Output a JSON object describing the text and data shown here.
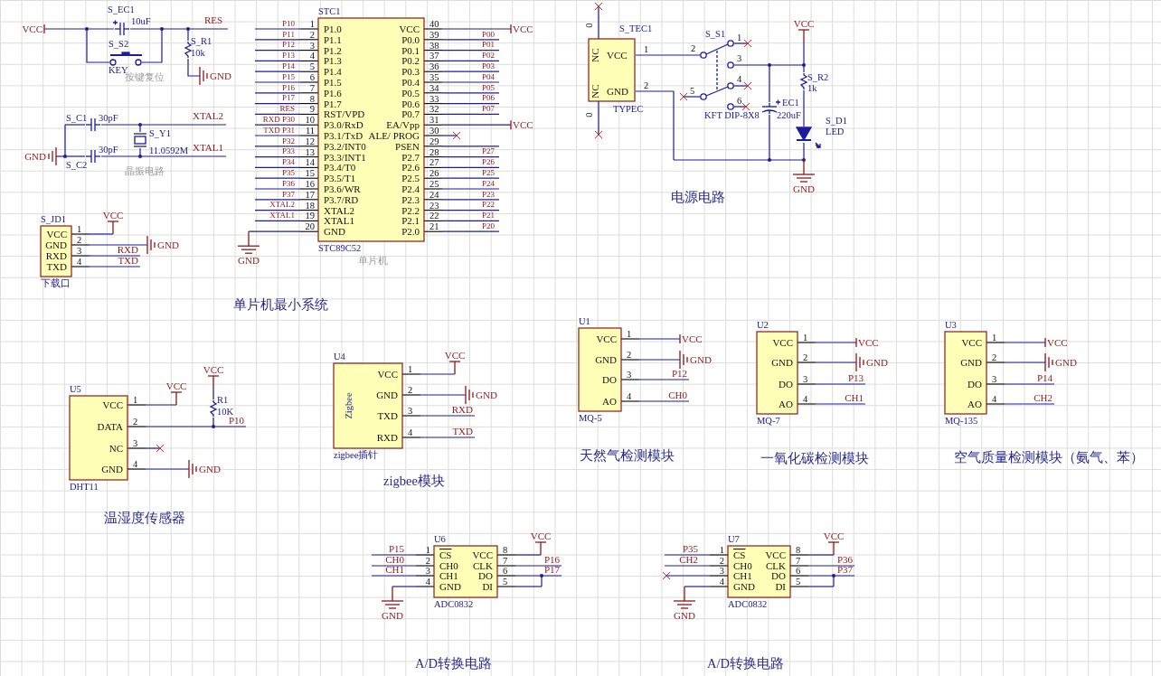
{
  "ics": [
    {
      "designator": "S_JD1",
      "part": "下载口",
      "pins_right": [
        {
          "number": "1",
          "name": "VCC",
          "net": "VCC",
          "kind": "power"
        },
        {
          "number": "2",
          "name": "GND",
          "net": "GND",
          "kind": "ground"
        },
        {
          "number": "3",
          "name": "RXD",
          "net": "RXD",
          "kind": "label"
        },
        {
          "number": "4",
          "name": "TXD",
          "net": "TXD",
          "kind": "label"
        }
      ]
    },
    {
      "designator": "STC1",
      "part": "STC89C52",
      "comment": "单片机",
      "pins_left": [
        {
          "number": "1",
          "name": "P1.0",
          "net": "P10",
          "kind": "label"
        },
        {
          "number": "2",
          "name": "P1.1",
          "net": "P11",
          "kind": "label"
        },
        {
          "number": "3",
          "name": "P1.2",
          "net": "P12",
          "kind": "label"
        },
        {
          "number": "4",
          "name": "P1.3",
          "net": "P13",
          "kind": "label"
        },
        {
          "number": "5",
          "name": "P1.4",
          "net": "P14",
          "kind": "label"
        },
        {
          "number": "6",
          "name": "P1.5",
          "net": "P15",
          "kind": "label"
        },
        {
          "number": "7",
          "name": "P1.6",
          "net": "P16",
          "kind": "label"
        },
        {
          "number": "8",
          "name": "P1.7",
          "net": "P17",
          "kind": "label"
        },
        {
          "number": "9",
          "name": "RST/VPD",
          "net": "RES",
          "kind": "label"
        },
        {
          "number": "10",
          "name": "P3.0/RxD",
          "net": "RXD P30",
          "kind": "label"
        },
        {
          "number": "11",
          "name": "P3.1/TxD",
          "net": "TXD P31",
          "kind": "label"
        },
        {
          "number": "12",
          "name": "P3.2/INT0",
          "net": "P32",
          "kind": "label"
        },
        {
          "number": "13",
          "name": "P3.3/INT1",
          "net": "P33",
          "kind": "label"
        },
        {
          "number": "14",
          "name": "P3.4/T0",
          "net": "P34",
          "kind": "label"
        },
        {
          "number": "15",
          "name": "P3.5/T1",
          "net": "P35",
          "kind": "label"
        },
        {
          "number": "16",
          "name": "P3.6/WR",
          "net": "P36",
          "kind": "label"
        },
        {
          "number": "17",
          "name": "P3.7/RD",
          "net": "P37",
          "kind": "label"
        },
        {
          "number": "18",
          "name": "XTAL2",
          "net": "XTAL2",
          "kind": "label"
        },
        {
          "number": "19",
          "name": "XTAL1",
          "net": "XTAL1",
          "kind": "label"
        },
        {
          "number": "20",
          "name": "GND",
          "net": "GND",
          "kind": "ground"
        }
      ],
      "pins_right": [
        {
          "number": "40",
          "name": "VCC",
          "net": "VCC",
          "kind": "power"
        },
        {
          "number": "39",
          "name": "P0.0",
          "net": "P00",
          "kind": "label"
        },
        {
          "number": "38",
          "name": "P0.1",
          "net": "P01",
          "kind": "label"
        },
        {
          "number": "37",
          "name": "P0.2",
          "net": "P02",
          "kind": "label"
        },
        {
          "number": "36",
          "name": "P0.3",
          "net": "P03",
          "kind": "label"
        },
        {
          "number": "35",
          "name": "P0.4",
          "net": "P04",
          "kind": "label"
        },
        {
          "number": "34",
          "name": "P0.5",
          "net": "P05",
          "kind": "label"
        },
        {
          "number": "33",
          "name": "P0.6",
          "net": "P06",
          "kind": "label"
        },
        {
          "number": "32",
          "name": "P0.7",
          "net": "P07",
          "kind": "label"
        },
        {
          "number": "31",
          "name": "EA/Vpp",
          "net": "VCC",
          "kind": "power"
        },
        {
          "number": "30",
          "name": "ALE/ PROG",
          "kind": "noconnect"
        },
        {
          "number": "29",
          "name": "PSEN",
          "kind": "plain"
        },
        {
          "number": "28",
          "name": "P2.7",
          "net": "P27",
          "kind": "label"
        },
        {
          "number": "27",
          "name": "P2.6",
          "net": "P26",
          "kind": "label"
        },
        {
          "number": "26",
          "name": "P2.5",
          "net": "P25",
          "kind": "label"
        },
        {
          "number": "25",
          "name": "P2.4",
          "net": "P24",
          "kind": "label"
        },
        {
          "number": "24",
          "name": "P2.3",
          "net": "P23",
          "kind": "label"
        },
        {
          "number": "23",
          "name": "P2.2",
          "net": "P22",
          "kind": "label"
        },
        {
          "number": "22",
          "name": "P2.1",
          "net": "P21",
          "kind": "label"
        },
        {
          "number": "21",
          "name": "P2.0",
          "net": "P20",
          "kind": "label"
        }
      ]
    },
    {
      "designator": "U5",
      "part": "DHT11",
      "pins_right": [
        {
          "number": "1",
          "name": "VCC",
          "net": "VCC",
          "kind": "power"
        },
        {
          "number": "2",
          "name": "DATA",
          "net": "P10",
          "kind": "label"
        },
        {
          "number": "3",
          "name": "NC",
          "kind": "noconnect"
        },
        {
          "number": "4",
          "name": "GND",
          "net": "GND",
          "kind": "ground"
        }
      ]
    },
    {
      "designator": "U4",
      "part": "zigbee插针",
      "body_label": "Zigbee",
      "pins_right": [
        {
          "number": "1",
          "name": "VCC",
          "net": "VCC",
          "kind": "power"
        },
        {
          "number": "2",
          "name": "GND",
          "net": "GND",
          "kind": "ground"
        },
        {
          "number": "3",
          "name": "TXD",
          "net": "RXD",
          "kind": "label"
        },
        {
          "number": "4",
          "name": "RXD",
          "net": "TXD",
          "kind": "label"
        }
      ]
    },
    {
      "designator": "U1",
      "part": "MQ-5",
      "pins_right": [
        {
          "number": "1",
          "name": "VCC",
          "net": "VCC",
          "kind": "power"
        },
        {
          "number": "2",
          "name": "GND",
          "net": "GND",
          "kind": "ground"
        },
        {
          "number": "3",
          "name": "DO",
          "net": "P12",
          "kind": "label"
        },
        {
          "number": "4",
          "name": "AO",
          "net": "CH0",
          "kind": "label"
        }
      ]
    },
    {
      "designator": "U2",
      "part": "MQ-7",
      "pins_right": [
        {
          "number": "1",
          "name": "VCC",
          "net": "VCC",
          "kind": "power"
        },
        {
          "number": "2",
          "name": "GND",
          "net": "GND",
          "kind": "ground"
        },
        {
          "number": "3",
          "name": "DO",
          "net": "P13",
          "kind": "label"
        },
        {
          "number": "4",
          "name": "AO",
          "net": "CH1",
          "kind": "label"
        }
      ]
    },
    {
      "designator": "U3",
      "part": "MQ-135",
      "pins_right": [
        {
          "number": "1",
          "name": "VCC",
          "net": "VCC",
          "kind": "power"
        },
        {
          "number": "2",
          "name": "GND",
          "net": "GND",
          "kind": "ground"
        },
        {
          "number": "3",
          "name": "DO",
          "net": "P14",
          "kind": "label"
        },
        {
          "number": "4",
          "name": "AO",
          "net": "CH2",
          "kind": "label"
        }
      ]
    },
    {
      "designator": "U6",
      "part": "ADC0832",
      "pins_left": [
        {
          "number": "1",
          "name": "CS",
          "active_low": true,
          "net": "P15",
          "kind": "label"
        },
        {
          "number": "2",
          "name": "CH0",
          "active_low": false,
          "net": "CH0",
          "kind": "label"
        },
        {
          "number": "3",
          "name": "CH1",
          "active_low": false,
          "net": "CH1",
          "kind": "label"
        },
        {
          "number": "4",
          "name": "GND",
          "active_low": false,
          "net": "GND",
          "kind": "ground"
        }
      ],
      "pins_right": [
        {
          "number": "8",
          "name": "VCC",
          "active_low": false,
          "net": "VCC",
          "kind": "power"
        },
        {
          "number": "7",
          "name": "CLK",
          "active_low": false,
          "net": "P16",
          "kind": "label"
        },
        {
          "number": "6",
          "name": "DO",
          "active_low": false,
          "net": "P17",
          "kind": "label"
        },
        {
          "number": "5",
          "name": "DI",
          "active_low": false,
          "kind": "plain"
        }
      ]
    },
    {
      "designator": "U7",
      "part": "ADC0832",
      "pins_left": [
        {
          "number": "1",
          "name": "CS",
          "active_low": true,
          "net": "P35",
          "kind": "label"
        },
        {
          "number": "2",
          "name": "CH0",
          "active_low": false,
          "net": "CH2",
          "kind": "label"
        },
        {
          "number": "3",
          "name": "CH1",
          "active_low": false,
          "kind": "noconnect"
        },
        {
          "number": "4",
          "name": "GND",
          "active_low": false,
          "net": "GND",
          "kind": "ground"
        }
      ],
      "pins_right": [
        {
          "number": "8",
          "name": "VCC",
          "active_low": false,
          "net": "VCC",
          "kind": "power"
        },
        {
          "number": "7",
          "name": "CLK",
          "active_low": false,
          "net": "P36",
          "kind": "label"
        },
        {
          "number": "6",
          "name": "DO",
          "active_low": false,
          "net": "P37",
          "kind": "label"
        },
        {
          "number": "5",
          "name": "DI",
          "active_low": false,
          "kind": "plain"
        }
      ]
    }
  ],
  "discretes": [
    {
      "kind": "capacitor",
      "designator": "S_EC1",
      "value": "10uF",
      "polarized": true
    },
    {
      "kind": "pushbutton",
      "designator": "S_S2",
      "value": "KEY"
    },
    {
      "kind": "resistor",
      "designator": "S_R1",
      "value": "10k"
    },
    {
      "kind": "capacitor",
      "designator": "S_C1",
      "value": "30pF",
      "polarized": false
    },
    {
      "kind": "capacitor",
      "designator": "S_C2",
      "value": "30pF",
      "polarized": false
    },
    {
      "kind": "crystal",
      "designator": "S_Y1",
      "value": "11.0592M"
    },
    {
      "kind": "resistor",
      "designator": "R1",
      "value": "10K"
    },
    {
      "kind": "connector",
      "designator": "S_TEC1",
      "value": "TYPEC",
      "pins": [
        {
          "number": "1",
          "name": "VCC",
          "side_name": "NC"
        },
        {
          "number": "2",
          "name": "GND",
          "side_name": "NC"
        }
      ],
      "end_pins": [
        "0",
        "0"
      ]
    },
    {
      "kind": "dip_switch",
      "designator": "S_S1",
      "value": "KFT DIP-8X8",
      "pins": [
        "1",
        "2",
        "3",
        "4",
        "5",
        "6"
      ]
    },
    {
      "kind": "capacitor",
      "designator": "EC1",
      "value": "220uF",
      "polarized": true
    },
    {
      "kind": "resistor",
      "designator": "S_R2",
      "value": "1k"
    },
    {
      "kind": "led",
      "designator": "S_D1",
      "value": "LED"
    }
  ],
  "net_labels": [
    {
      "text": "VCC",
      "kind": "power"
    },
    {
      "text": "RES",
      "kind": "label"
    },
    {
      "text": "GND",
      "kind": "ground"
    },
    {
      "text": "XTAL2",
      "kind": "label"
    },
    {
      "text": "XTAL1",
      "kind": "label"
    },
    {
      "text": "GND",
      "kind": "ground"
    },
    {
      "text": "VCC",
      "kind": "power"
    },
    {
      "text": "GND",
      "kind": "ground"
    },
    {
      "text": "VCC",
      "kind": "power"
    }
  ],
  "titles": [
    "单片机最小系统",
    "电源电路",
    "温湿度传感器",
    "zigbee模块",
    "天然气检测模块",
    "一氧化碳检测模块",
    "空气质量检测模块（氨气、苯）",
    "A/D转换电路",
    "A/D转换电路"
  ],
  "comments": [
    "按键复位",
    "晶振电路"
  ]
}
